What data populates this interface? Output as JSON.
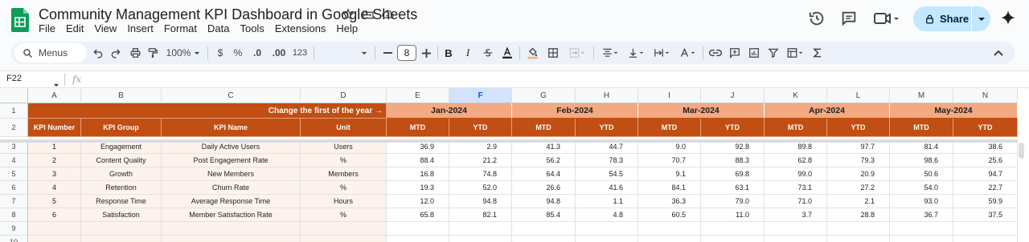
{
  "app": {
    "title": "Community Management KPI Dashboard in Google Sheets",
    "menu": [
      "File",
      "Edit",
      "View",
      "Insert",
      "Format",
      "Data",
      "Tools",
      "Extensions",
      "Help"
    ],
    "share_label": "Share",
    "brand_color": "#0f9d58"
  },
  "toolbar": {
    "search_label": "Menus",
    "zoom": "100%",
    "currency": "$",
    "percent": "%",
    "dec_decrease": ".0",
    "dec_increase": ".00",
    "number_format": "123",
    "font_size": "8",
    "bold": "B",
    "italic": "I"
  },
  "formula_bar": {
    "cell_ref": "F22",
    "fx": "fx"
  },
  "grid": {
    "columns": [
      "A",
      "B",
      "C",
      "D",
      "E",
      "F",
      "G",
      "H",
      "I",
      "J",
      "K",
      "L",
      "M",
      "N"
    ],
    "selected_column": "F",
    "rows": [
      "1",
      "2",
      "3",
      "4",
      "5",
      "6",
      "7",
      "8",
      "9",
      "10"
    ],
    "banner_text": "Change the first of the year →",
    "months": [
      "Jan-2024",
      "Feb-2024",
      "Mar-2024",
      "Apr-2024",
      "May-2024"
    ],
    "headers": [
      "KPI Number",
      "KPI Group",
      "KPI Name",
      "Unit"
    ],
    "sub_headers": [
      "MTD",
      "YTD"
    ],
    "data_rows": [
      {
        "num": "1",
        "group": "Engagement",
        "name": "Daily Active Users",
        "unit": "Users",
        "values": [
          "36.9",
          "2.9",
          "41.3",
          "44.7",
          "9.0",
          "92.8",
          "89.8",
          "97.7",
          "81.4",
          "38.6"
        ]
      },
      {
        "num": "2",
        "group": "Content Quality",
        "name": "Post Engagement Rate",
        "unit": "%",
        "values": [
          "88.4",
          "21.2",
          "56.2",
          "78.3",
          "70.7",
          "88.3",
          "62.8",
          "79.3",
          "98.6",
          "25.6"
        ]
      },
      {
        "num": "3",
        "group": "Growth",
        "name": "New Members",
        "unit": "Members",
        "values": [
          "16.8",
          "74.8",
          "64.4",
          "54.5",
          "9.1",
          "69.8",
          "99.0",
          "20.9",
          "50.6",
          "94.7"
        ]
      },
      {
        "num": "4",
        "group": "Retention",
        "name": "Churn Rate",
        "unit": "%",
        "values": [
          "19.3",
          "52.0",
          "26.6",
          "41.6",
          "84.1",
          "63.1",
          "73.1",
          "27.2",
          "54.0",
          "22.7"
        ]
      },
      {
        "num": "5",
        "group": "Response Time",
        "name": "Average Response Time",
        "unit": "Hours",
        "values": [
          "12.0",
          "94.8",
          "94.8",
          "1.1",
          "36.3",
          "79.0",
          "71.0",
          "2.1",
          "93.0",
          "59.9"
        ]
      },
      {
        "num": "6",
        "group": "Satisfaction",
        "name": "Member Satisfaction Rate",
        "unit": "%",
        "values": [
          "65.8",
          "82.1",
          "85.4",
          "4.8",
          "60.5",
          "11.0",
          "3.7",
          "28.8",
          "36.7",
          "37.5"
        ]
      }
    ],
    "colors": {
      "header_dark": "#c14e12",
      "header_light": "#f3a981",
      "cream": "#fdf3ec"
    }
  }
}
